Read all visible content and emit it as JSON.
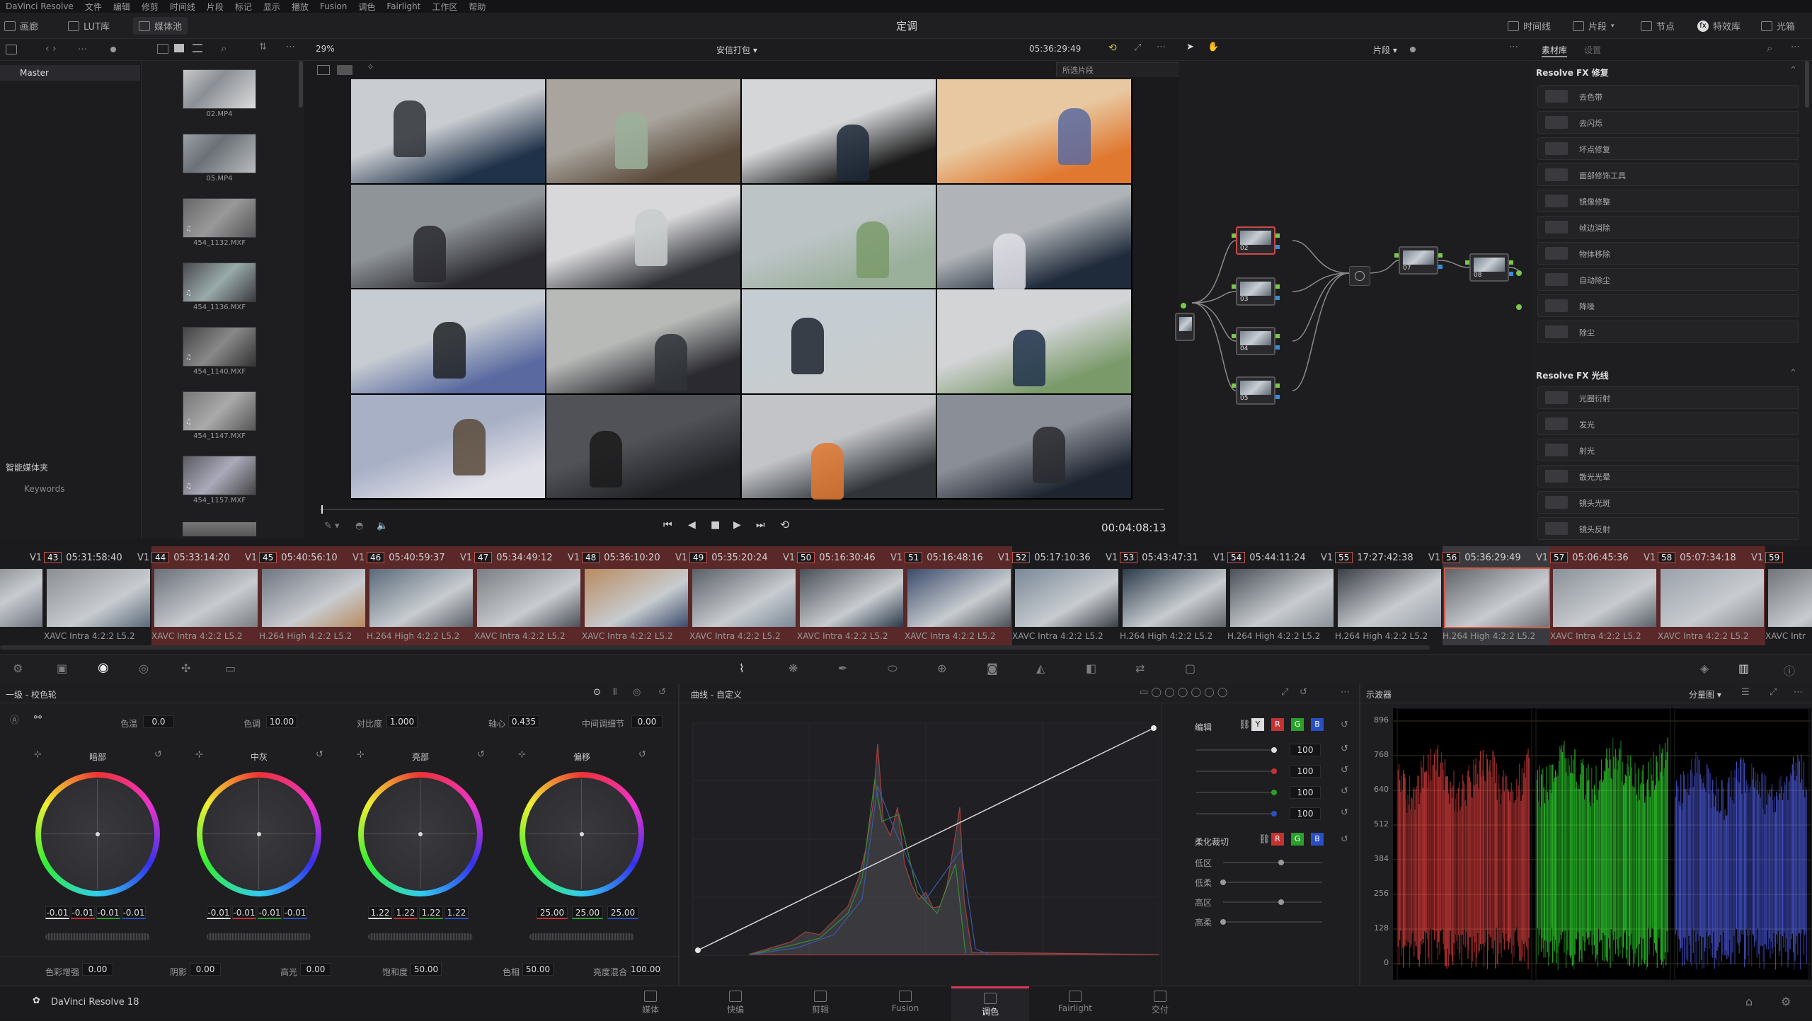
{
  "app": {
    "menu": [
      "DaVinci Resolve",
      "文件",
      "编辑",
      "修剪",
      "时间线",
      "片段",
      "标记",
      "显示",
      "播放",
      "Fusion",
      "调色",
      "Fairlight",
      "工作区",
      "帮助"
    ],
    "page_title": "定调",
    "footer_app": "DaVinci Resolve 18"
  },
  "toolbar_left": [
    "画廊",
    "LUT库",
    "媒体池"
  ],
  "toolbar_right": [
    "时间线",
    "片段",
    "节点",
    "特效库",
    "光箱"
  ],
  "viewer": {
    "zoom": "29%",
    "clip_group": "安信打包",
    "timecode": "05:36:29:49",
    "mode": "片段",
    "angle_select": "所选片段",
    "playhead_tc": "00:04:08:13"
  },
  "media_pool": {
    "root": "Master",
    "smart_bins": "智能媒体夹",
    "keywords": "Keywords",
    "items": [
      "02.MP4",
      "05.MP4",
      "454_1132.MXF",
      "454_1136.MXF",
      "454_1140.MXF",
      "454_1147.MXF",
      "454_1157.MXF"
    ]
  },
  "library_tabs": [
    "素材库",
    "设置"
  ],
  "fx": {
    "section1": "Resolve FX 修复",
    "items1": [
      "去色带",
      "去闪烁",
      "坏点修复",
      "面部修饰工具",
      "镜像修整",
      "帧边消除",
      "物体移除",
      "自动除尘",
      "降噪",
      "除尘"
    ],
    "section2": "Resolve FX 光线",
    "items2": [
      "光圈衍射",
      "发光",
      "射光",
      "散光光晕",
      "镜头光斑",
      "镜头反射"
    ]
  },
  "nodes": [
    "02",
    "03",
    "04",
    "05",
    "07",
    "08"
  ],
  "clips": [
    {
      "num": "",
      "tc": "4:40",
      "track": "V1",
      "codec": "2:2 L5.2"
    },
    {
      "num": "43",
      "tc": "05:31:58:40",
      "track": "V1",
      "codec": "XAVC Intra 4:2:2 L5.2"
    },
    {
      "num": "44",
      "tc": "05:33:14:20",
      "track": "V1",
      "codec": "XAVC Intra 4:2:2 L5.2"
    },
    {
      "num": "45",
      "tc": "05:40:56:10",
      "track": "V1",
      "codec": "H.264 High 4:2:2 L5.2"
    },
    {
      "num": "46",
      "tc": "05:40:59:37",
      "track": "V1",
      "codec": "H.264 High 4:2:2 L5.2"
    },
    {
      "num": "47",
      "tc": "05:34:49:12",
      "track": "V1",
      "codec": "XAVC Intra 4:2:2 L5.2"
    },
    {
      "num": "48",
      "tc": "05:36:10:20",
      "track": "V1",
      "codec": "XAVC Intra 4:2:2 L5.2"
    },
    {
      "num": "49",
      "tc": "05:35:20:24",
      "track": "V1",
      "codec": "XAVC Intra 4:2:2 L5.2"
    },
    {
      "num": "50",
      "tc": "05:16:30:46",
      "track": "V1",
      "codec": "XAVC Intra 4:2:2 L5.2"
    },
    {
      "num": "51",
      "tc": "05:16:48:16",
      "track": "V1",
      "codec": "XAVC Intra 4:2:2 L5.2"
    },
    {
      "num": "52",
      "tc": "05:17:10:36",
      "track": "V1",
      "codec": "XAVC Intra 4:2:2 L5.2"
    },
    {
      "num": "53",
      "tc": "05:43:47:31",
      "track": "V1",
      "codec": "H.264 High 4:2:2 L5.2"
    },
    {
      "num": "54",
      "tc": "05:44:11:24",
      "track": "V1",
      "codec": "H.264 High 4:2:2 L5.2"
    },
    {
      "num": "55",
      "tc": "17:27:42:38",
      "track": "V1",
      "codec": "H.264 High 4:2:2 L5.2"
    },
    {
      "num": "56",
      "tc": "05:36:29:49",
      "track": "V1",
      "codec": "H.264 High 4:2:2 L5.2"
    },
    {
      "num": "57",
      "tc": "05:06:45:36",
      "track": "V1",
      "codec": "XAVC Intra 4:2:2 L5.2"
    },
    {
      "num": "58",
      "tc": "05:07:34:18",
      "track": "V1",
      "codec": "XAVC Intra 4:2:2 L5.2"
    },
    {
      "num": "59",
      "tc": "",
      "track": "V1",
      "codec": "XAVC Intr"
    }
  ],
  "primaries": {
    "title": "一级 - 校色轮",
    "temp_label": "色温",
    "temp": "0.0",
    "tint_label": "色调",
    "tint": "10.00",
    "contrast_label": "对比度",
    "contrast": "1.000",
    "pivot_label": "轴心",
    "pivot": "0.435",
    "mid_label": "中间调细节",
    "mid": "0.00",
    "wheels": [
      {
        "name": "暗部",
        "values": [
          "-0.01",
          "-0.01",
          "-0.01",
          "-0.01"
        ]
      },
      {
        "name": "中灰",
        "values": [
          "-0.01",
          "-0.01",
          "-0.01",
          "-0.01"
        ]
      },
      {
        "name": "亮部",
        "values": [
          "1.22",
          "1.22",
          "1.22",
          "1.22"
        ]
      },
      {
        "name": "偏移",
        "values": [
          "25.00",
          "25.00",
          "25.00"
        ]
      }
    ],
    "bottom": [
      {
        "l": "色彩增强",
        "v": "0.00"
      },
      {
        "l": "阴影",
        "v": "0.00"
      },
      {
        "l": "高光",
        "v": "0.00"
      },
      {
        "l": "饱和度",
        "v": "50.00"
      },
      {
        "l": "色相",
        "v": "50.00"
      },
      {
        "l": "亮度混合",
        "v": "100.00"
      }
    ]
  },
  "curves": {
    "title": "曲线 - 自定义",
    "edit": "编辑",
    "soft": "柔化裁切",
    "vals": [
      "100",
      "100",
      "100",
      "100"
    ],
    "soft_labels": [
      "低区",
      "低柔",
      "高区",
      "高柔"
    ]
  },
  "scope": {
    "title": "示波器",
    "mode": "分量图",
    "ticks": [
      "896",
      "768",
      "640",
      "512",
      "384",
      "256",
      "128",
      "0"
    ]
  },
  "pages": [
    "媒体",
    "快编",
    "剪辑",
    "Fusion",
    "调色",
    "Fairlight",
    "交付"
  ]
}
